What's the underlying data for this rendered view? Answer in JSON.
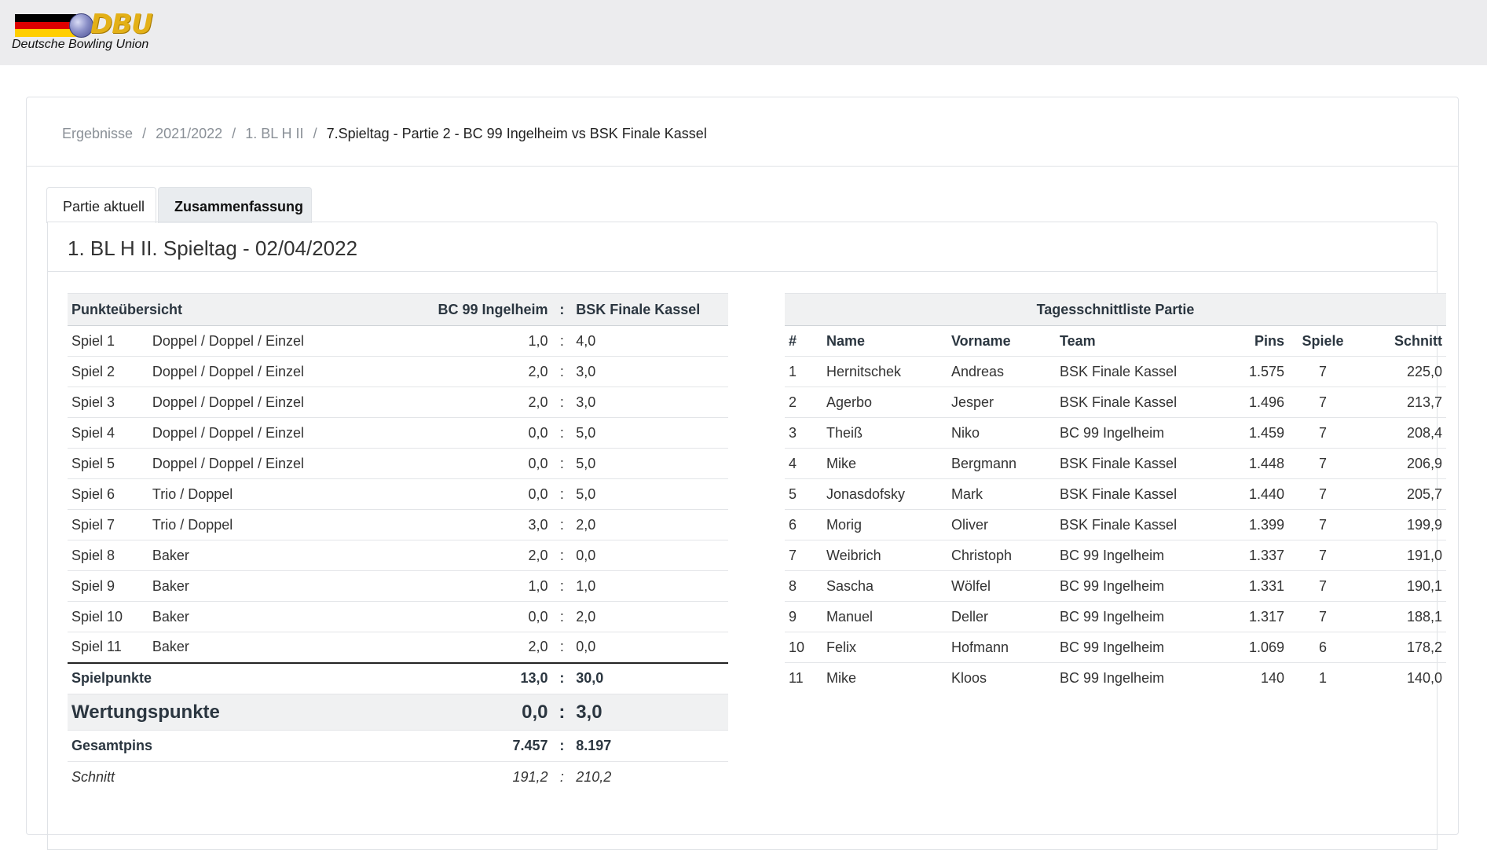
{
  "header": {
    "logo_text": "DBU",
    "logo_subtitle": "Deutsche Bowling Union",
    "flag_colors": [
      "#000000",
      "#dd0000",
      "#ffce00"
    ]
  },
  "breadcrumb": {
    "items": [
      "Ergebnisse",
      "2021/2022",
      "1. BL H II"
    ],
    "current": "7.Spieltag - Partie 2 - BC 99 Ingelheim vs BSK Finale Kassel"
  },
  "tabs": [
    {
      "label": "Partie aktuell",
      "active": false
    },
    {
      "label": "Zusammenfassung",
      "active": true
    }
  ],
  "panel_title": "1. BL H II. Spieltag - 02/04/2022",
  "points": {
    "header": {
      "label": "Punkteübersicht",
      "team_a": "BC 99 Ingelheim",
      "colon": ":",
      "team_b": "BSK Finale Kassel"
    },
    "games": [
      {
        "name": "Spiel 1",
        "mode": "Doppel / Doppel / Einzel",
        "a": "1,0",
        "b": "4,0"
      },
      {
        "name": "Spiel 2",
        "mode": "Doppel / Doppel / Einzel",
        "a": "2,0",
        "b": "3,0"
      },
      {
        "name": "Spiel 3",
        "mode": "Doppel / Doppel / Einzel",
        "a": "2,0",
        "b": "3,0"
      },
      {
        "name": "Spiel 4",
        "mode": "Doppel / Doppel / Einzel",
        "a": "0,0",
        "b": "5,0"
      },
      {
        "name": "Spiel 5",
        "mode": "Doppel / Doppel / Einzel",
        "a": "0,0",
        "b": "5,0"
      },
      {
        "name": "Spiel 6",
        "mode": "Trio / Doppel",
        "a": "0,0",
        "b": "5,0"
      },
      {
        "name": "Spiel 7",
        "mode": "Trio / Doppel",
        "a": "3,0",
        "b": "2,0"
      },
      {
        "name": "Spiel 8",
        "mode": "Baker",
        "a": "2,0",
        "b": "0,0"
      },
      {
        "name": "Spiel 9",
        "mode": "Baker",
        "a": "1,0",
        "b": "1,0"
      },
      {
        "name": "Spiel 10",
        "mode": "Baker",
        "a": "0,0",
        "b": "2,0"
      },
      {
        "name": "Spiel 11",
        "mode": "Baker",
        "a": "2,0",
        "b": "0,0"
      }
    ],
    "spielpunkte": {
      "label": "Spielpunkte",
      "a": "13,0",
      "b": "30,0"
    },
    "wertungspunkte": {
      "label": "Wertungspunkte",
      "a": "0,0",
      "b": "3,0"
    },
    "gesamtpins": {
      "label": "Gesamtpins",
      "a": "7.457",
      "b": "8.197"
    },
    "schnitt": {
      "label": "Schnitt",
      "a": "191,2",
      "b": "210,2"
    }
  },
  "ranking": {
    "caption": "Tagesschnittliste Partie",
    "columns": {
      "num": "#",
      "name": "Name",
      "vorname": "Vorname",
      "team": "Team",
      "pins": "Pins",
      "spiele": "Spiele",
      "schnitt": "Schnitt"
    },
    "rows": [
      {
        "num": "1",
        "name": "Hernitschek",
        "vorname": "Andreas",
        "team": "BSK Finale Kassel",
        "pins": "1.575",
        "spiele": "7",
        "schnitt": "225,0"
      },
      {
        "num": "2",
        "name": "Agerbo",
        "vorname": "Jesper",
        "team": "BSK Finale Kassel",
        "pins": "1.496",
        "spiele": "7",
        "schnitt": "213,7"
      },
      {
        "num": "3",
        "name": "Theiß",
        "vorname": "Niko",
        "team": "BC 99 Ingelheim",
        "pins": "1.459",
        "spiele": "7",
        "schnitt": "208,4"
      },
      {
        "num": "4",
        "name": "Mike",
        "vorname": "Bergmann",
        "team": "BSK Finale Kassel",
        "pins": "1.448",
        "spiele": "7",
        "schnitt": "206,9"
      },
      {
        "num": "5",
        "name": "Jonasdofsky",
        "vorname": "Mark",
        "team": "BSK Finale Kassel",
        "pins": "1.440",
        "spiele": "7",
        "schnitt": "205,7"
      },
      {
        "num": "6",
        "name": "Morig",
        "vorname": "Oliver",
        "team": "BSK Finale Kassel",
        "pins": "1.399",
        "spiele": "7",
        "schnitt": "199,9"
      },
      {
        "num": "7",
        "name": "Weibrich",
        "vorname": "Christoph",
        "team": "BC 99 Ingelheim",
        "pins": "1.337",
        "spiele": "7",
        "schnitt": "191,0"
      },
      {
        "num": "8",
        "name": "Sascha",
        "vorname": "Wölfel",
        "team": "BC 99 Ingelheim",
        "pins": "1.331",
        "spiele": "7",
        "schnitt": "190,1"
      },
      {
        "num": "9",
        "name": "Manuel",
        "vorname": "Deller",
        "team": "BC 99 Ingelheim",
        "pins": "1.317",
        "spiele": "7",
        "schnitt": "188,1"
      },
      {
        "num": "10",
        "name": "Felix",
        "vorname": "Hofmann",
        "team": "BC 99 Ingelheim",
        "pins": "1.069",
        "spiele": "6",
        "schnitt": "178,2"
      },
      {
        "num": "11",
        "name": "Mike",
        "vorname": "Kloos",
        "team": "BC 99 Ingelheim",
        "pins": "140",
        "spiele": "1",
        "schnitt": "140,0"
      }
    ]
  }
}
